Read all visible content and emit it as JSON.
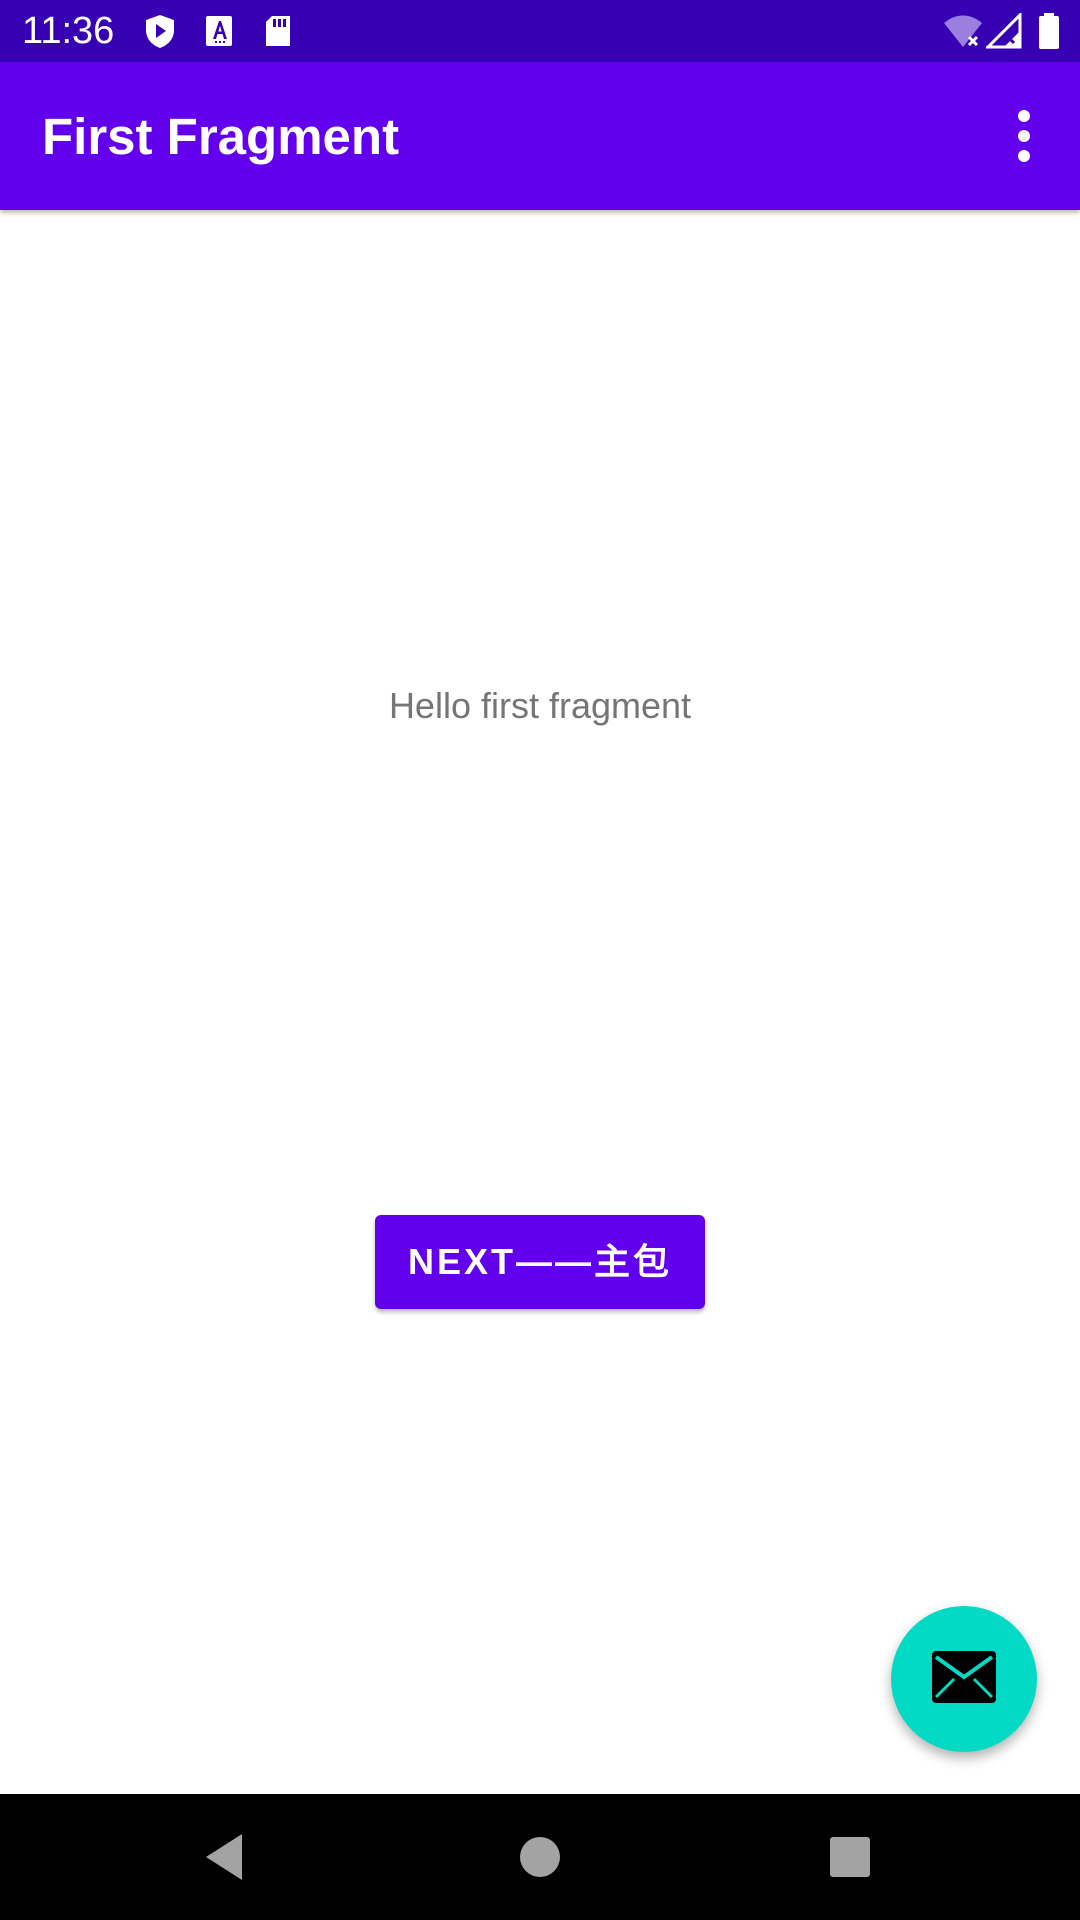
{
  "status_bar": {
    "time": "11:36",
    "icons": [
      "shield-play-icon",
      "accessibility-a-icon",
      "sd-card-icon",
      "wifi-off-icon",
      "signal-off-icon",
      "battery-icon"
    ],
    "background": "#3700b3"
  },
  "app_bar": {
    "title": "First Fragment",
    "menu_icon": "more-vertical-icon",
    "background": "#6200ee"
  },
  "content": {
    "hello_text": "Hello first fragment",
    "next_button_label": "NEXT——主包",
    "button_color": "#6200ee"
  },
  "fab": {
    "icon": "mail-icon",
    "background": "#03dac5"
  },
  "nav_bar": {
    "buttons": [
      "back-icon",
      "home-icon",
      "recents-icon"
    ],
    "background": "#000000"
  }
}
